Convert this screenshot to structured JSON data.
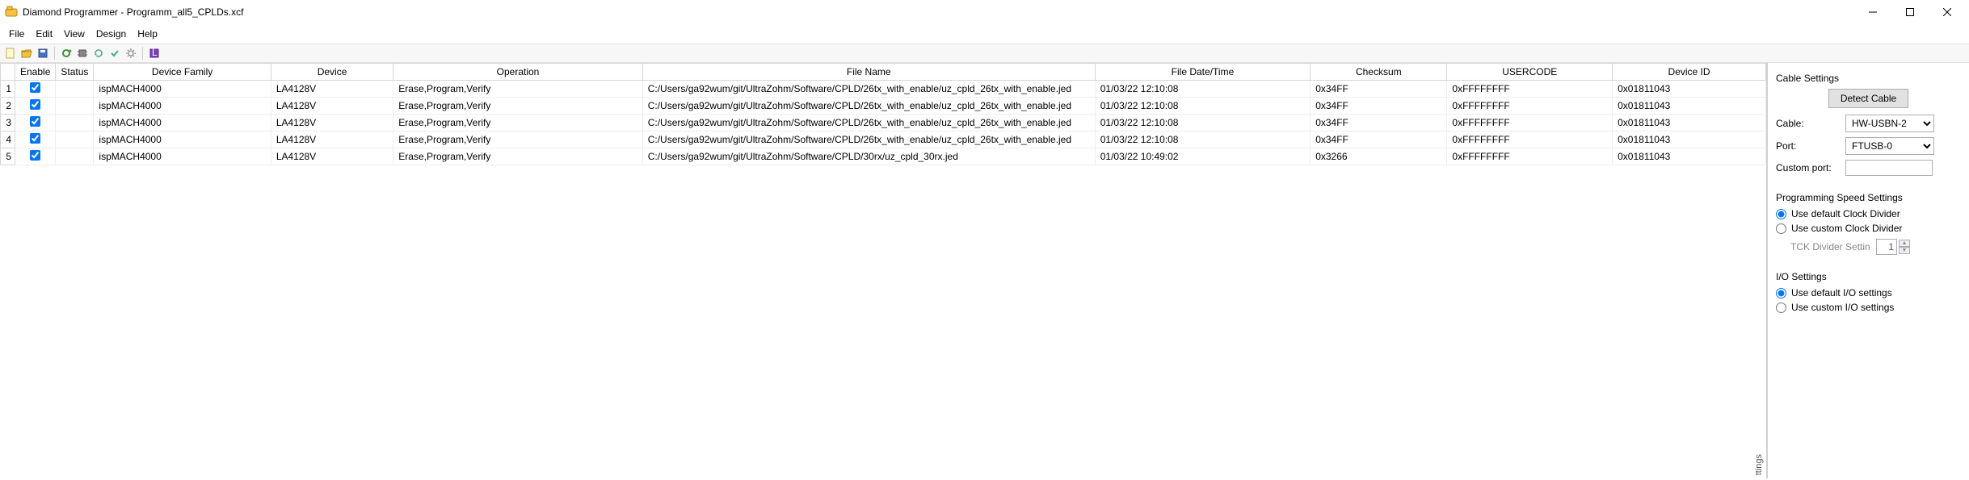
{
  "window": {
    "title": "Diamond Programmer - Programm_all5_CPLDs.xcf"
  },
  "menu": {
    "file": "File",
    "edit": "Edit",
    "view": "View",
    "design": "Design",
    "help": "Help"
  },
  "columns": {
    "enable": "Enable",
    "status": "Status",
    "family": "Device Family",
    "device": "Device",
    "operation": "Operation",
    "filename": "File Name",
    "filedate": "File Date/Time",
    "checksum": "Checksum",
    "usercode": "USERCODE",
    "deviceid": "Device ID"
  },
  "rows": [
    {
      "n": "1",
      "enable": true,
      "family": "ispMACH4000",
      "device": "LA4128V",
      "operation": "Erase,Program,Verify",
      "filename": "C:/Users/ga92wum/git/UltraZohm/Software/CPLD/26tx_with_enable/uz_cpld_26tx_with_enable.jed",
      "filedate": "01/03/22 12:10:08",
      "checksum": "0x34FF",
      "usercode": "0xFFFFFFFF",
      "deviceid": "0x01811043"
    },
    {
      "n": "2",
      "enable": true,
      "family": "ispMACH4000",
      "device": "LA4128V",
      "operation": "Erase,Program,Verify",
      "filename": "C:/Users/ga92wum/git/UltraZohm/Software/CPLD/26tx_with_enable/uz_cpld_26tx_with_enable.jed",
      "filedate": "01/03/22 12:10:08",
      "checksum": "0x34FF",
      "usercode": "0xFFFFFFFF",
      "deviceid": "0x01811043"
    },
    {
      "n": "3",
      "enable": true,
      "family": "ispMACH4000",
      "device": "LA4128V",
      "operation": "Erase,Program,Verify",
      "filename": "C:/Users/ga92wum/git/UltraZohm/Software/CPLD/26tx_with_enable/uz_cpld_26tx_with_enable.jed",
      "filedate": "01/03/22 12:10:08",
      "checksum": "0x34FF",
      "usercode": "0xFFFFFFFF",
      "deviceid": "0x01811043"
    },
    {
      "n": "4",
      "enable": true,
      "family": "ispMACH4000",
      "device": "LA4128V",
      "operation": "Erase,Program,Verify",
      "filename": "C:/Users/ga92wum/git/UltraZohm/Software/CPLD/26tx_with_enable/uz_cpld_26tx_with_enable.jed",
      "filedate": "01/03/22 12:10:08",
      "checksum": "0x34FF",
      "usercode": "0xFFFFFFFF",
      "deviceid": "0x01811043"
    },
    {
      "n": "5",
      "enable": true,
      "family": "ispMACH4000",
      "device": "LA4128V",
      "operation": "Erase,Program,Verify",
      "filename": "C:/Users/ga92wum/git/UltraZohm/Software/CPLD/30rx/uz_cpld_30rx.jed",
      "filedate": "01/03/22 10:49:02",
      "checksum": "0x3266",
      "usercode": "0xFFFFFFFF",
      "deviceid": "0x01811043"
    }
  ],
  "side": {
    "cable_settings_title": "Cable Settings",
    "detect_cable": "Detect Cable",
    "cable_label": "Cable:",
    "cable_value": "HW-USBN-2",
    "port_label": "Port:",
    "port_value": "FTUSB-0",
    "custom_port_label": "Custom port:",
    "custom_port_value": "",
    "speed_title": "Programming Speed Settings",
    "speed_default": "Use default Clock Divider",
    "speed_custom": "Use custom Clock Divider",
    "tck_label": "TCK Divider Settin",
    "tck_value": "1",
    "io_title": "I/O Settings",
    "io_default": "Use default I/O settings",
    "io_custom": "Use custom I/O settings"
  },
  "vtab": "ttings"
}
